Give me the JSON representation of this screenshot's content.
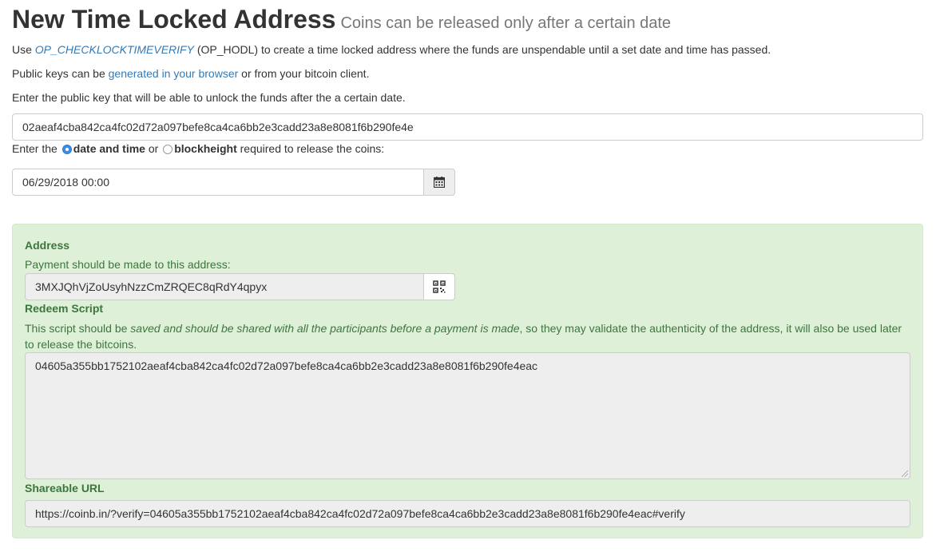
{
  "header": {
    "title": "New Time Locked Address",
    "subtitle": "Coins can be released only after a certain date"
  },
  "intro": {
    "p1_prefix": "Use ",
    "p1_link": "OP_CHECKLOCKTIMEVERIFY",
    "p1_suffix": " (OP_HODL) to create a time locked address where the funds are unspendable until a set date and time has passed.",
    "p2_prefix": "Public keys can be ",
    "p2_link": "generated in your browser",
    "p2_suffix": " or from your bitcoin client.",
    "p3": "Enter the public key that will be able to unlock the funds after the a certain date."
  },
  "pubkey": {
    "value": "02aeaf4cba842ca4fc02d72a097befe8ca4ca6bb2e3cadd23a8e8081f6b290fe4e"
  },
  "release": {
    "prefix": "Enter the ",
    "option_date": "date and time",
    "middle": " or ",
    "option_block": "blockheight",
    "suffix": " required to release the coins:",
    "selected": "date and time",
    "date_value": "06/29/2018 00:00"
  },
  "result": {
    "address_label": "Address",
    "address_help": "Payment should be made to this address:",
    "address_value": "3MXJQhVjZoUsyhNzzCmZRQEC8qRdY4qpyx",
    "redeem_label": "Redeem Script",
    "redeem_help_prefix": "This script should be ",
    "redeem_help_italic": "saved and should be shared with all the participants before a payment is made",
    "redeem_help_suffix": ", so they may validate the authenticity of the address, it will also be used later",
    "redeem_help_line2": "to release the bitcoins.",
    "redeem_value": "04605a355bb1752102aeaf4cba842ca4fc02d72a097befe8ca4ca6bb2e3cadd23a8e8081f6b290fe4eac",
    "url_label": "Shareable URL",
    "url_value": "https://coinb.in/?verify=04605a355bb1752102aeaf4cba842ca4fc02d72a097befe8ca4ca6bb2e3cadd23a8e8081f6b290fe4eac#verify"
  },
  "icons": {
    "calendar": "calendar-icon",
    "qrcode": "qrcode-icon"
  },
  "colors": {
    "link": "#337ab7",
    "success_bg": "#dff0d8",
    "success_text": "#3c763d"
  }
}
